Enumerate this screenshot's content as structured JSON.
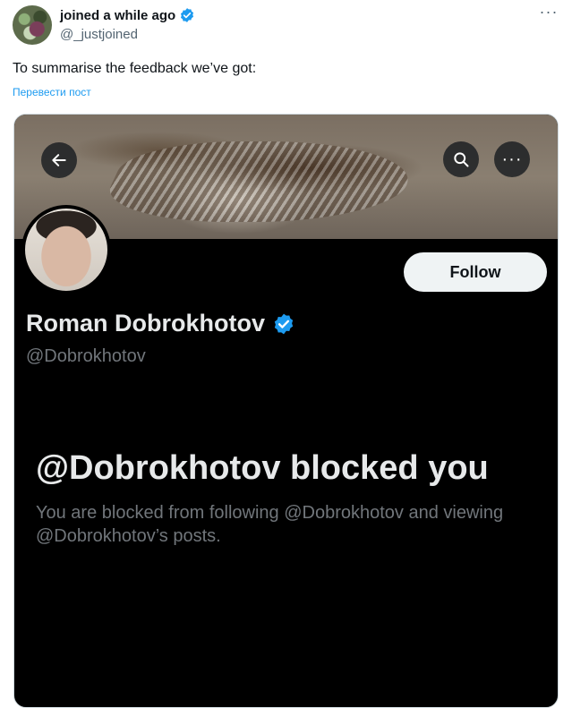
{
  "post": {
    "author_name": "joined a while ago",
    "author_handle": "@_justjoined",
    "text": "To summarise the feedback we’ve got:",
    "translate_label": "Перевести пост",
    "more_label": "···"
  },
  "screenshot": {
    "more_label": "···",
    "follow_label": "Follow",
    "profile_name": "Roman Dobrokhotov",
    "profile_handle": "@Dobrokhotov",
    "blocked_title": "@Dobrokhotov blocked you",
    "blocked_subtitle": "You are blocked from following @Dobrokhotov and viewing @Dobrokhotov’s posts."
  },
  "colors": {
    "verified": "#1d9bf0",
    "link": "#1d9bf0",
    "dark_bg": "#000000"
  },
  "icons": [
    "verified-badge-icon",
    "more-icon",
    "back-arrow-icon",
    "search-icon"
  ]
}
